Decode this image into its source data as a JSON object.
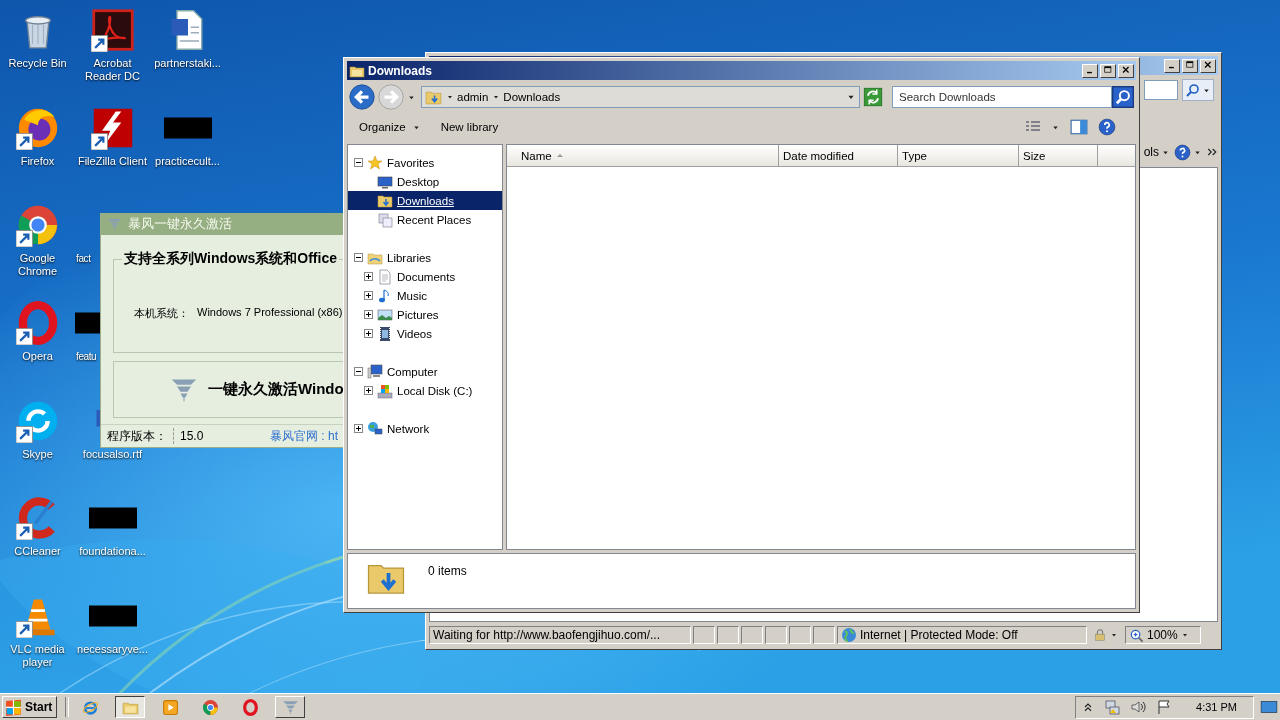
{
  "desktop": {
    "columns": [
      [
        {
          "label": "Recycle Bin",
          "kind": "recycle",
          "shortcut": false
        },
        {
          "label": "Firefox",
          "kind": "firefox",
          "shortcut": true
        },
        {
          "label": "Google Chrome",
          "kind": "chrome",
          "shortcut": true
        },
        {
          "label": "Opera",
          "kind": "opera",
          "shortcut": true
        },
        {
          "label": "Skype",
          "kind": "skype",
          "shortcut": true
        },
        {
          "label": "CCleaner",
          "kind": "ccleaner",
          "shortcut": true
        },
        {
          "label": "VLC media player",
          "kind": "vlc",
          "shortcut": true
        }
      ],
      [
        {
          "label": "Acrobat Reader DC",
          "kind": "acrobat",
          "shortcut": true
        },
        {
          "label": "FileZilla Client",
          "kind": "filezilla",
          "shortcut": true
        },
        {
          "label": "fact",
          "kind": "hidden"
        },
        {
          "label": "featu",
          "kind": "redacted",
          "shortcut": false
        },
        {
          "label": "focusalso.rtf",
          "kind": "word",
          "shortcut": false
        },
        {
          "label": "foundationa...",
          "kind": "redacted",
          "shortcut": false
        },
        {
          "label": "necessaryve...",
          "kind": "redacted",
          "shortcut": false
        }
      ],
      [
        {
          "label": "partnerstaki...",
          "kind": "word",
          "shortcut": false
        },
        {
          "label": "practicecult...",
          "kind": "redacted",
          "shortcut": false
        }
      ]
    ]
  },
  "ie_window": {
    "command_text": "ols",
    "status_text": "Waiting for http://www.baofengjihuo.com/...",
    "zone": "Internet | Protected Mode: Off",
    "zoom": "100%"
  },
  "activator_window": {
    "title": "暴风一键永久激活",
    "heading": "支持全系列Windows系统和Office",
    "system_label": "本机系统：",
    "system_value": "Windows 7 Professional (x86)",
    "activate_button": "一键永久激活Windo",
    "version_label": "程序版本：",
    "version": "15.0",
    "website_link": "暴风官网 : ht"
  },
  "explorer_window": {
    "title": "Downloads",
    "breadcrumbs": [
      "admin",
      "Downloads"
    ],
    "search": {
      "placeholder": "Search Downloads"
    },
    "toolbar": [
      {
        "label": "Organize",
        "kind": "menu"
      },
      {
        "label": "New library",
        "kind": "button"
      }
    ],
    "nav_tree": [
      {
        "label": "Favorites",
        "expanded": true,
        "selected": false,
        "children": [
          {
            "label": "Desktop",
            "selected": false
          },
          {
            "label": "Downloads",
            "selected": true
          },
          {
            "label": "Recent Places",
            "selected": false
          }
        ]
      },
      {
        "label": "Libraries",
        "expanded": true,
        "selected": false,
        "children": [
          {
            "label": "Documents",
            "expanded": false,
            "selected": false
          },
          {
            "label": "Music",
            "expanded": false,
            "selected": false
          },
          {
            "label": "Pictures",
            "expanded": false,
            "selected": false
          },
          {
            "label": "Videos",
            "expanded": false,
            "selected": false
          }
        ]
      },
      {
        "label": "Computer",
        "expanded": true,
        "selected": false,
        "children": [
          {
            "label": "Local Disk (C:)",
            "expanded": false,
            "selected": false
          }
        ]
      },
      {
        "label": "Network",
        "expanded": false,
        "selected": false
      }
    ],
    "columns": [
      {
        "label": "Name",
        "sorted": true
      },
      {
        "label": "Date modified",
        "sorted": false
      },
      {
        "label": "Type",
        "sorted": false
      },
      {
        "label": "Size",
        "sorted": false
      }
    ],
    "item_count": "0 items"
  },
  "taskbar": {
    "start": "Start",
    "buttons": [
      {
        "kind": "ie",
        "selected": false
      },
      {
        "kind": "explorer",
        "selected": true
      },
      {
        "kind": "media",
        "selected": false
      },
      {
        "kind": "chrome",
        "selected": false
      },
      {
        "kind": "opera",
        "selected": false
      },
      {
        "kind": "tornado",
        "selected": false
      }
    ],
    "clock": "4:31 PM"
  }
}
